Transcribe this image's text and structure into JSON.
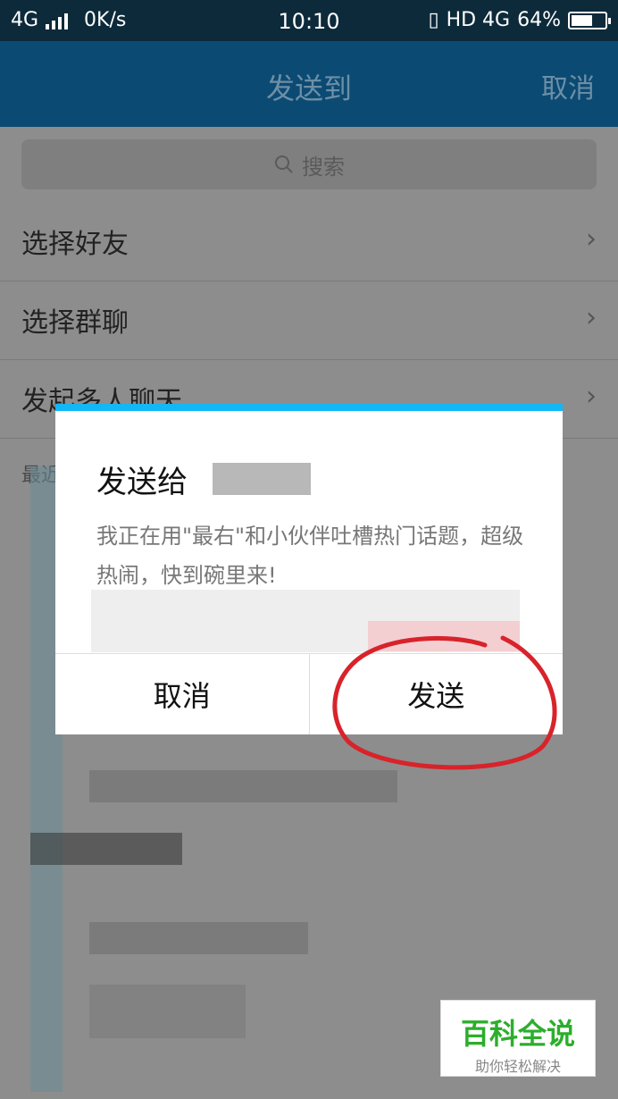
{
  "status_bar": {
    "network": "4G",
    "speed": "0K/s",
    "time": "10:10",
    "right_indicators": "HD 4G",
    "battery": "64%",
    "battery_level": 0.64
  },
  "header": {
    "title": "发送到",
    "cancel_label": "取消"
  },
  "search": {
    "placeholder": "搜索"
  },
  "menu": [
    {
      "label": "选择好友"
    },
    {
      "label": "选择群聊"
    },
    {
      "label": "发起多人聊天"
    }
  ],
  "recent_label": "最近",
  "dialog": {
    "title": "发送给",
    "message": "我正在用\"最右\"和小伙伴吐槽热门话题，超级热闹，快到碗里来!",
    "cancel_label": "取消",
    "send_label": "发送"
  },
  "watermark": {
    "main": "百科全说",
    "sub": "助你轻松解决"
  },
  "colors": {
    "accent": "#12b7f5",
    "header_bg": "#0b4a73",
    "annotation": "#d8232a",
    "watermark_green": "#2cae2c"
  }
}
